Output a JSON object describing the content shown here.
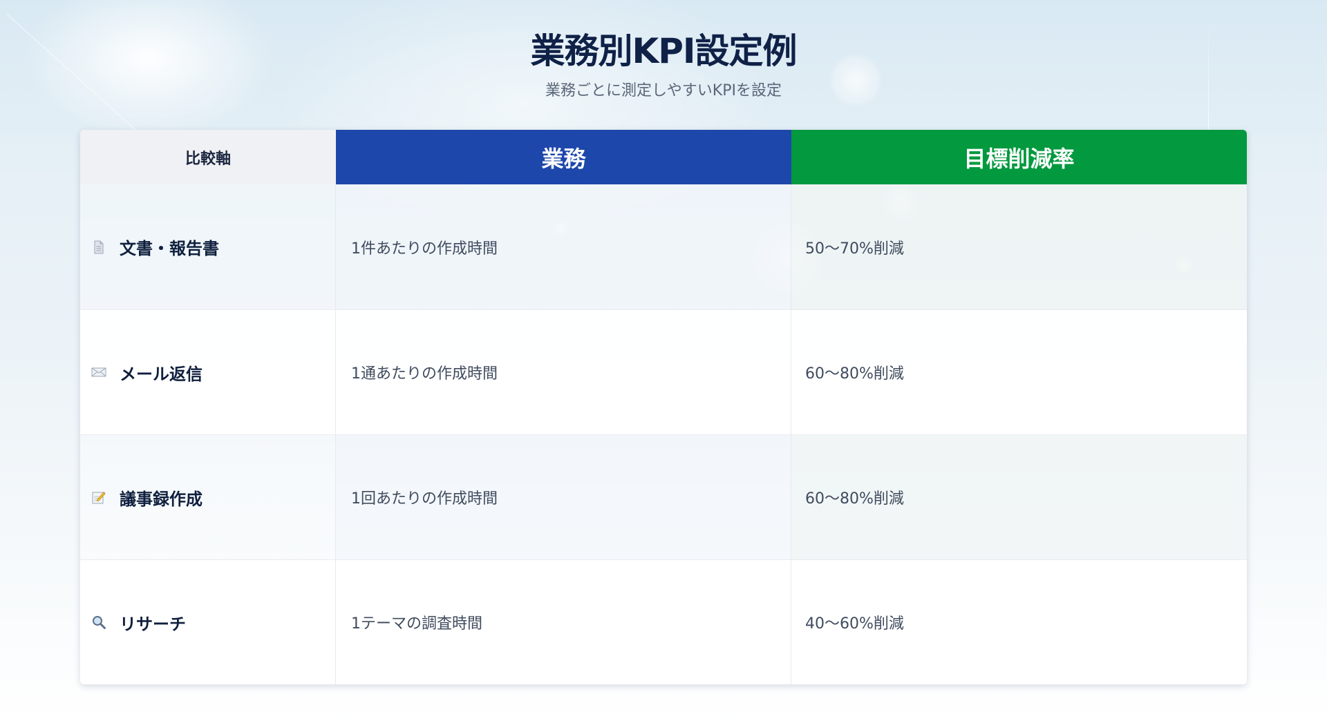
{
  "header": {
    "title": "業務別KPI設定例",
    "subtitle": "業務ごとに測定しやすいKPIを設定"
  },
  "table": {
    "columns": [
      "比較軸",
      "業務",
      "目標削減率"
    ],
    "column_colors": {
      "task": "#1e47ab",
      "target": "#03993f",
      "axis": "#f0f1f4"
    },
    "rows": [
      {
        "icon": "document-icon",
        "label": "文書・報告書",
        "task": "1件あたりの作成時間",
        "target": "50〜70%削減"
      },
      {
        "icon": "envelope-icon",
        "label": "メール返信",
        "task": "1通あたりの作成時間",
        "target": "60〜80%削減"
      },
      {
        "icon": "memo-pencil-icon",
        "label": "議事録作成",
        "task": "1回あたりの作成時間",
        "target": "60〜80%削減"
      },
      {
        "icon": "magnifier-icon",
        "label": "リサーチ",
        "task": "1テーマの調査時間",
        "target": "40〜60%削減"
      }
    ]
  }
}
